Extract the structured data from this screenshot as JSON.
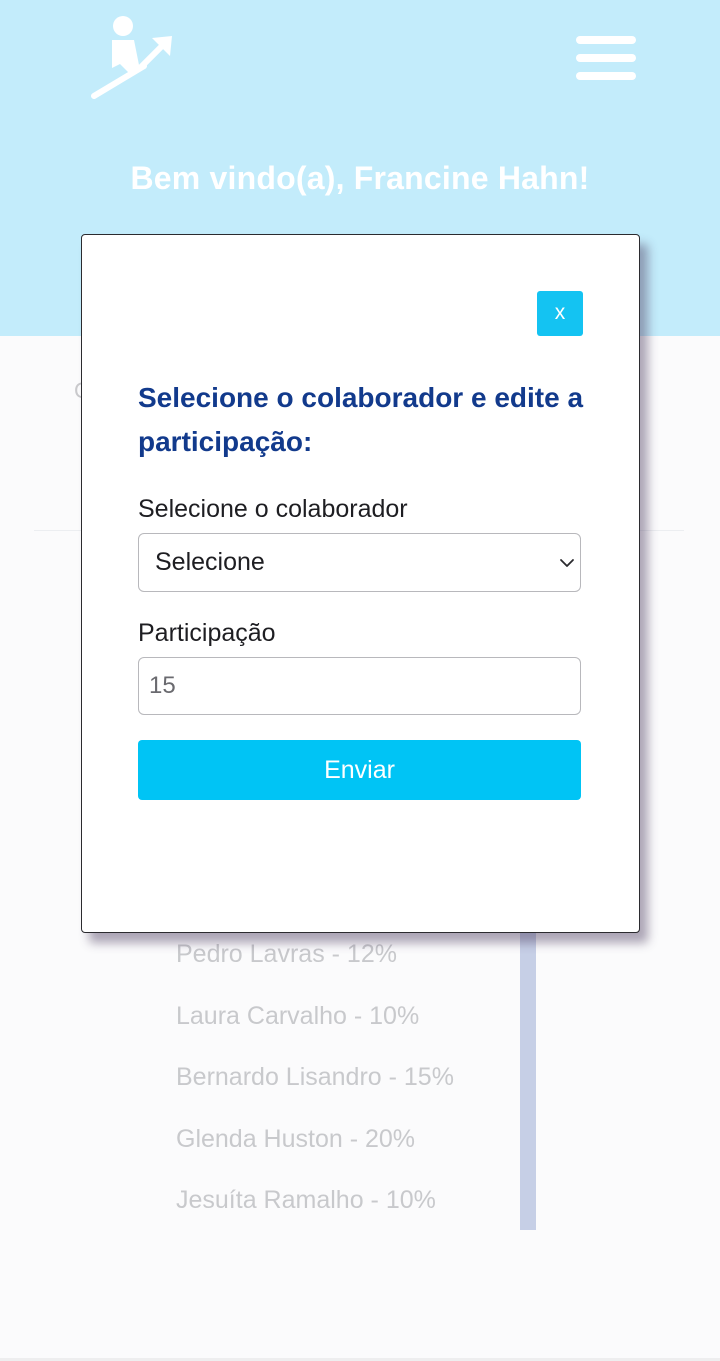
{
  "header": {
    "welcome": "Bem vindo(a), Francine Hahn!",
    "logo_icon": "person-growth-arrow-icon",
    "menu_icon": "hamburger-menu-icon",
    "background_color": "#c3ecfb"
  },
  "background": {
    "partial_char": "C",
    "collaborators": [
      "Pedro Lavras - 12%",
      "Laura Carvalho - 10%",
      "Bernardo Lisandro - 15%",
      "Glenda Huston - 20%",
      "Jesuíta Ramalho - 10%"
    ]
  },
  "modal": {
    "close_label": "x",
    "title": "Selecione o colaborador e edite a participação:",
    "collaborator_label": "Selecione o colaborador",
    "collaborator_selected": "Selecione",
    "participation_label": "Participação",
    "participation_value": "15",
    "submit_label": "Enviar",
    "accent_color": "#00c4f5",
    "title_color": "#123a8c"
  }
}
